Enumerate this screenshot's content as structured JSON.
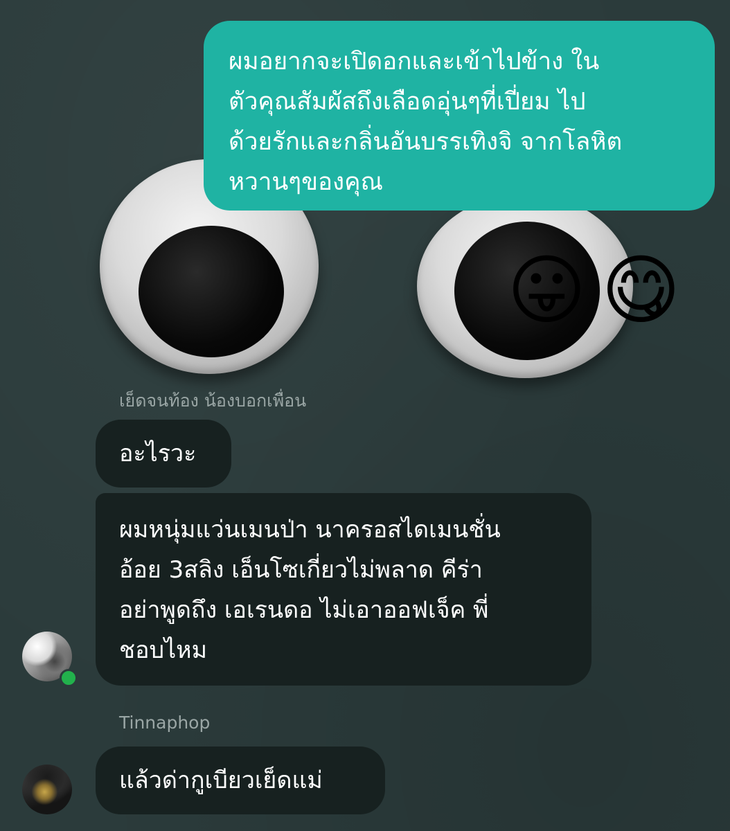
{
  "sticker": {
    "emojis": [
      "😛",
      "😋"
    ]
  },
  "outgoing_message": {
    "lines": [
      "ผมอยากจะเปิดอกและเข้าไปข้าง ใน",
      "ตัวคุณสัมผัสถึงเลือดอุ่นๆที่เปี่ยม ไป",
      "ด้วยรักและกลิ่นอันบรรเทิงจิ จากโลหิต",
      "หวานๆของคุณ"
    ]
  },
  "groups": [
    {
      "sender": "เย็ดจนท้อง น้องบอกเพื่อน",
      "messages": [
        {
          "lines": [
            "อะไรวะ"
          ]
        },
        {
          "lines": [
            "ผมหนุ่มแว่นเมนป่า นาครอสไดเมนชั่น",
            "อ้อย 3สลิง เอ็นโซเกี่ยวไม่พลาด คีร่า",
            "อย่าพูดถึง เอเรนดอ ไม่เอาออฟเจ็ค พี่",
            "ชอบไหม"
          ]
        }
      ],
      "online": true
    },
    {
      "sender": "Tinnaphop",
      "messages": [
        {
          "lines": [
            "แล้วด่ากูเบียวเย็ดแม่"
          ]
        }
      ]
    }
  ],
  "colors": {
    "background": "#2b3b3b",
    "outgoing_bubble": "#1fb3a3",
    "incoming_bubble": "#172120",
    "sender_name": "#9aa6a5",
    "online_indicator": "#22b14c"
  }
}
